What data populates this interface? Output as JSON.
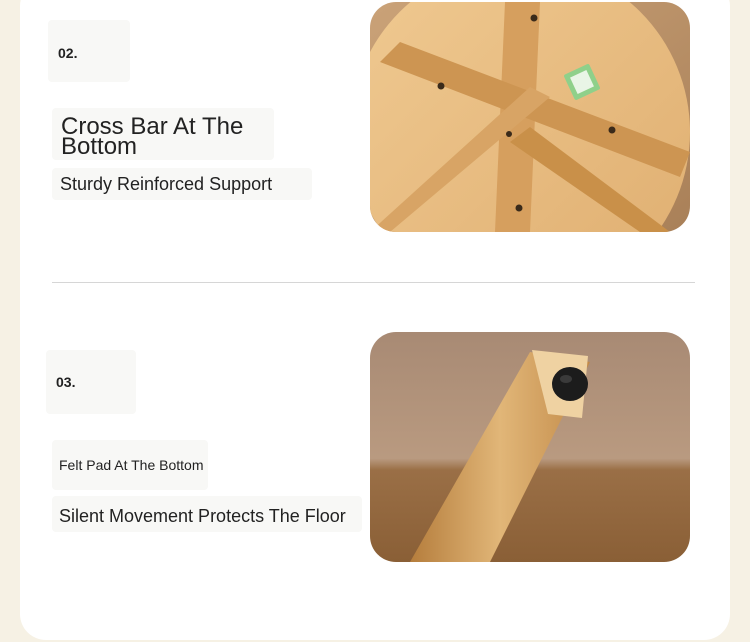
{
  "sections": [
    {
      "number": "02.",
      "title": "Cross Bar At The Bottom",
      "subtitle": "Sturdy Reinforced Support",
      "image": "wooden-table-underside-cross-bars"
    },
    {
      "number": "03.",
      "title": "Felt Pad At The Bottom",
      "subtitle": "Silent Movement Protects The Floor",
      "image": "table-leg-felt-pad"
    }
  ],
  "colors": {
    "page_background": "#f6f1e4",
    "card_background": "#ffffff",
    "wood_light": "#e7bd84",
    "wood_dark": "#b57d3c",
    "felt_pad": "#1c1c1c"
  }
}
